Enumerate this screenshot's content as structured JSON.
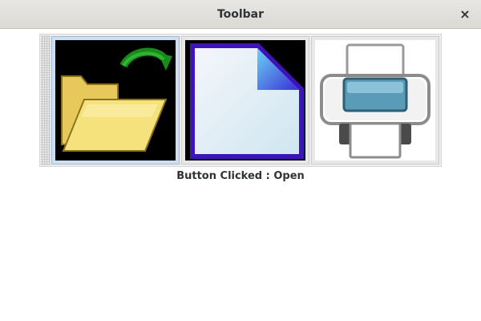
{
  "window": {
    "title": "Toolbar",
    "close_glyph": "×"
  },
  "toolbar": {
    "buttons": [
      {
        "name": "Open",
        "icon": "open-folder-icon",
        "selected": true
      },
      {
        "name": "New",
        "icon": "new-document-icon",
        "selected": false
      },
      {
        "name": "Print",
        "icon": "printer-icon",
        "selected": false
      }
    ]
  },
  "status": {
    "text": "Button Clicked : Open"
  },
  "colors": {
    "selected_button_bg": "#cfdff1",
    "titlebar_bg": "#dcdad5"
  }
}
